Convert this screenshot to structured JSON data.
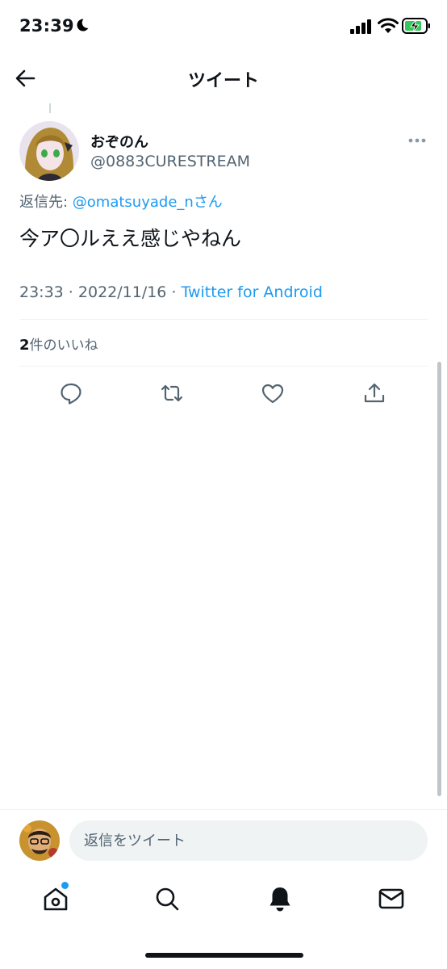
{
  "status_bar": {
    "time": "23:39",
    "icons": [
      "moon-icon",
      "signal-icon",
      "wifi-icon",
      "battery-charging-icon"
    ]
  },
  "header": {
    "title": "ツイート",
    "back_icon": "back-arrow-icon"
  },
  "tweet": {
    "display_name": "おぞのん",
    "handle": "@0883CURESTREAM",
    "reply_prefix": "返信先: ",
    "reply_to": "@omatsuyade_n",
    "reply_suffix": "さん",
    "text": "今ア〇ルええ感じやねん",
    "time": "23:33",
    "separator": " · ",
    "date": "2022/11/16",
    "source": "Twitter for Android",
    "likes_count": "2",
    "likes_label": "件のいいね",
    "actions": [
      "reply-icon",
      "retweet-icon",
      "like-icon",
      "share-icon"
    ]
  },
  "composer": {
    "placeholder": "返信をツイート"
  },
  "tab_bar": {
    "tabs": [
      "home-icon",
      "search-icon",
      "notifications-icon",
      "messages-icon"
    ]
  },
  "colors": {
    "accent": "#1d9bf0",
    "text_primary": "#0f1419",
    "text_secondary": "#536471",
    "divider": "#eff3f4"
  }
}
